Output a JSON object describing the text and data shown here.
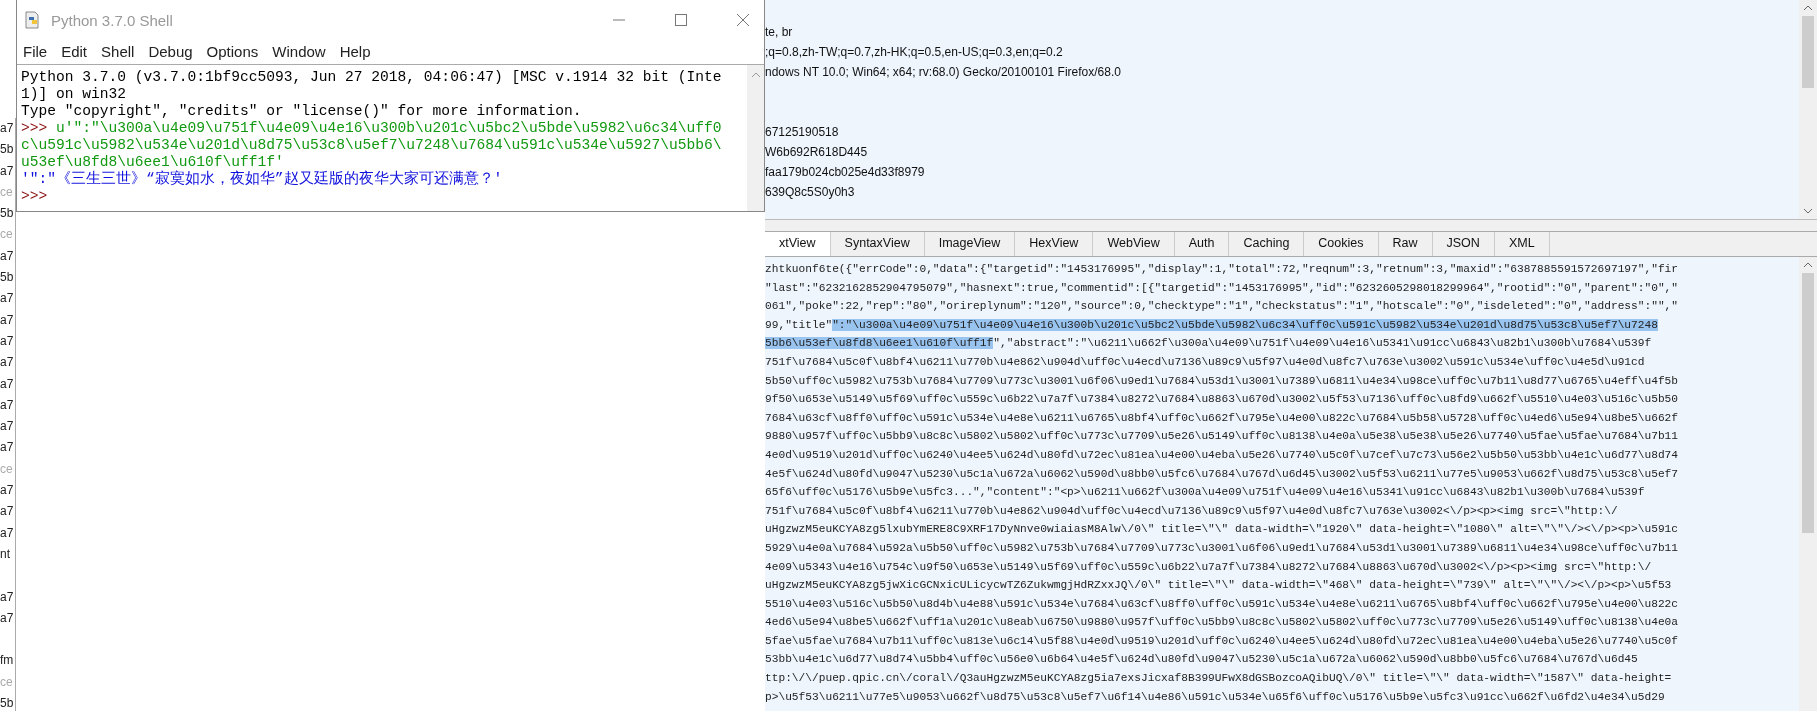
{
  "sessions": [
    {
      "kind": "text",
      "text": "a7",
      "dimmed": false
    },
    {
      "kind": "text",
      "text": "5b",
      "dimmed": false
    },
    {
      "kind": "text",
      "text": "a7",
      "dimmed": false
    },
    {
      "kind": "text",
      "text": "ce",
      "dimmed": true
    },
    {
      "kind": "text",
      "text": "5b",
      "dimmed": false
    },
    {
      "kind": "text",
      "text": "ce",
      "dimmed": true
    },
    {
      "kind": "text",
      "text": "a7",
      "dimmed": false
    },
    {
      "kind": "text",
      "text": "5b",
      "dimmed": false
    },
    {
      "kind": "text",
      "text": "a7",
      "dimmed": false
    },
    {
      "kind": "text",
      "text": "a7",
      "dimmed": false
    },
    {
      "kind": "text",
      "text": "a7",
      "dimmed": false
    },
    {
      "kind": "text",
      "text": "a7",
      "dimmed": false
    },
    {
      "kind": "text",
      "text": "a7",
      "dimmed": false
    },
    {
      "kind": "text",
      "text": "a7",
      "dimmed": false
    },
    {
      "kind": "text",
      "text": "a7",
      "dimmed": false
    },
    {
      "kind": "text",
      "text": "a7",
      "dimmed": false
    },
    {
      "kind": "text",
      "text": "ce",
      "dimmed": true
    },
    {
      "kind": "text",
      "text": "a7",
      "dimmed": false
    },
    {
      "kind": "text",
      "text": "a7",
      "dimmed": false
    },
    {
      "kind": "text",
      "text": "a7",
      "dimmed": false
    },
    {
      "kind": "text",
      "text": "nt",
      "dimmed": false
    },
    {
      "kind": "blank"
    },
    {
      "kind": "text",
      "text": "a7",
      "dimmed": false
    },
    {
      "kind": "text",
      "text": "a7",
      "dimmed": false
    },
    {
      "kind": "blank"
    },
    {
      "kind": "text",
      "text": "fm",
      "dimmed": false
    },
    {
      "kind": "text",
      "text": "ce",
      "dimmed": true
    },
    {
      "kind": "text",
      "text": "5b",
      "dimmed": false
    }
  ],
  "shell": {
    "title": "Python 3.7.0 Shell",
    "menu": [
      "File",
      "Edit",
      "Shell",
      "Debug",
      "Options",
      "Window",
      "Help"
    ],
    "lines": [
      {
        "parts": [
          {
            "kind": "stdout",
            "text": "Python 3.7.0 (v3.7.0:1bf9cc5093, Jun 27 2018, 04:06:47) [MSC v.1914 32 bit (Inte"
          }
        ]
      },
      {
        "parts": [
          {
            "kind": "stdout",
            "text": "1)] on win32"
          }
        ]
      },
      {
        "parts": [
          {
            "kind": "stdout",
            "text": "Type \"copyright\", \"credits\" or \"license()\" for more information."
          }
        ]
      },
      {
        "parts": [
          {
            "kind": "prompt",
            "text": ">>>"
          },
          {
            "kind": "stdin",
            "text": " u'\":\"\\u300a\\u4e09\\u751f\\u4e09\\u4e16\\u300b\\u201c\\u5bc2\\u5bde\\u5982\\u6c34\\uff0"
          }
        ]
      },
      {
        "parts": [
          {
            "kind": "stdin",
            "text": "c\\u591c\\u5982\\u534e\\u201d\\u8d75\\u53c8\\u5ef7\\u7248\\u7684\\u591c\\u534e\\u5927\\u5bb6\\"
          }
        ]
      },
      {
        "parts": [
          {
            "kind": "stdin",
            "text": "u53ef\\u8fd8\\u6ee1\\u610f\\uff1f'"
          }
        ]
      },
      {
        "parts": [
          {
            "kind": "result",
            "text": "'\":\"《三生三世》“寂寞如水，夜如华”赵又廷版的夜华大家可还满意？'"
          }
        ]
      },
      {
        "parts": [
          {
            "kind": "prompt",
            "text": ">>>"
          }
        ]
      }
    ]
  },
  "inspector": {
    "header_lines": [
      {
        "kind": "blank"
      },
      {
        "kind": "text",
        "text": "te, br"
      },
      {
        "kind": "text",
        "text": ";q=0.8,zh-TW;q=0.7,zh-HK;q=0.5,en-US;q=0.3,en;q=0.2"
      },
      {
        "kind": "text",
        "text": "ndows NT 10.0; Win64; x64; rv:68.0) Gecko/20100101 Firefox/68.0"
      },
      {
        "kind": "blank"
      },
      {
        "kind": "blank"
      },
      {
        "kind": "text",
        "text": "67125190518"
      },
      {
        "kind": "text",
        "text": "W6b692R618D445"
      },
      {
        "kind": "text",
        "text": "faa179b024cb025e4d33f8979"
      },
      {
        "kind": "text",
        "text": "639Q8c5S0y0h3"
      }
    ],
    "tabs": [
      {
        "label": "xtView",
        "selected": true
      },
      {
        "label": "SyntaxView",
        "selected": false
      },
      {
        "label": "ImageView",
        "selected": false
      },
      {
        "label": "HexView",
        "selected": false
      },
      {
        "label": "WebView",
        "selected": false
      },
      {
        "label": "Auth",
        "selected": false
      },
      {
        "label": "Caching",
        "selected": false
      },
      {
        "label": "Cookies",
        "selected": false
      },
      {
        "label": "Raw",
        "selected": false
      },
      {
        "label": "JSON",
        "selected": false
      },
      {
        "label": "XML",
        "selected": false
      }
    ],
    "body_lines": [
      {
        "parts": [
          {
            "text": "zhtkuonf6te({\"errCode\":0,\"data\":{\"targetid\":\"1453176995\",\"display\":1,\"total\":72,\"reqnum\":3,\"retnum\":3,\"maxid\":\"6387885591572697197\",\"fir",
            "highlighted": false
          }
        ]
      },
      {
        "parts": [
          {
            "text": "\"last\":\"6232162852904795079\",\"hasnext\":true,\"commentid\":[{\"targetid\":\"1453176995\",\"id\":\"6232605298018299964\",\"rootid\":\"0\",\"parent\":\"0\",\"",
            "highlighted": false
          }
        ]
      },
      {
        "parts": [
          {
            "text": "061\",\"poke\":22,\"rep\":\"80\",\"orireplynum\":\"120\",\"source\":0,\"checktype\":\"1\",\"checkstatus\":\"1\",\"hotscale\":\"0\",\"isdeleted\":\"0\",\"address\":\"\",\"",
            "highlighted": false
          }
        ]
      },
      {
        "parts": [
          {
            "text": "99,\"title\"",
            "highlighted": false
          },
          {
            "text": "\":\"\\u300a\\u4e09\\u751f\\u4e09\\u4e16\\u300b\\u201c\\u5bc2\\u5bde\\u5982\\u6c34\\uff0c\\u591c\\u5982\\u534e\\u201d\\u8d75\\u53c8\\u5ef7\\u7248",
            "highlighted": true
          }
        ]
      },
      {
        "parts": [
          {
            "text": "5bb6\\u53ef\\u8fd8\\u6ee1\\u610f\\uff1f",
            "highlighted": true
          },
          {
            "text": "\",\"abstract\":\"\\u6211\\u662f\\u300a\\u4e09\\u751f\\u4e09\\u4e16\\u5341\\u91cc\\u6843\\u82b1\\u300b\\u7684\\u539f",
            "highlighted": false
          }
        ]
      },
      {
        "parts": [
          {
            "text": "751f\\u7684\\u5c0f\\u8bf4\\u6211\\u770b\\u4e862\\u904d\\uff0c\\u4ecd\\u7136\\u89c9\\u5f97\\u4e0d\\u8fc7\\u763e\\u3002\\u591c\\u534e\\uff0c\\u4e5d\\u91cd",
            "highlighted": false
          }
        ]
      },
      {
        "parts": [
          {
            "text": "5b50\\uff0c\\u5982\\u753b\\u7684\\u7709\\u773c\\u3001\\u6f06\\u9ed1\\u7684\\u53d1\\u3001\\u7389\\u6811\\u4e34\\u98ce\\uff0c\\u7b11\\u8d77\\u6765\\u4eff\\u4f5b",
            "highlighted": false
          }
        ]
      },
      {
        "parts": [
          {
            "text": "9f50\\u653e\\u5149\\u5f69\\uff0c\\u559c\\u6b22\\u7a7f\\u7384\\u8272\\u7684\\u8863\\u670d\\u3002\\u5f53\\u7136\\uff0c\\u8fd9\\u662f\\u5510\\u4e03\\u516c\\u5b50",
            "highlighted": false
          }
        ]
      },
      {
        "parts": [
          {
            "text": "7684\\u63cf\\u8ff0\\uff0c\\u591c\\u534e\\u4e8e\\u6211\\u6765\\u8bf4\\uff0c\\u662f\\u795e\\u4e00\\u822c\\u7684\\u5b58\\u5728\\uff0c\\u4ed6\\u5e94\\u8be5\\u662f",
            "highlighted": false
          }
        ]
      },
      {
        "parts": [
          {
            "text": "9880\\u957f\\uff0c\\u5bb9\\u8c8c\\u5802\\u5802\\uff0c\\u773c\\u7709\\u5e26\\u5149\\uff0c\\u8138\\u4e0a\\u5e38\\u5e38\\u5e26\\u7740\\u5fae\\u5fae\\u7684\\u7b11",
            "highlighted": false
          }
        ]
      },
      {
        "parts": [
          {
            "text": "4e0d\\u9519\\u201d\\uff0c\\u6240\\u4ee5\\u624d\\u80fd\\u72ec\\u81ea\\u4e00\\u4eba\\u5e26\\u7740\\u5c0f\\u7cef\\u7c73\\u56e2\\u5b50\\u53bb\\u4e1c\\u6d77\\u8d74",
            "highlighted": false
          }
        ]
      },
      {
        "parts": [
          {
            "text": "4e5f\\u624d\\u80fd\\u9047\\u5230\\u5c1a\\u672a\\u6062\\u590d\\u8bb0\\u5fc6\\u7684\\u767d\\u6d45\\u3002\\u5f53\\u6211\\u77e5\\u9053\\u662f\\u8d75\\u53c8\\u5ef7",
            "highlighted": false
          }
        ]
      },
      {
        "parts": [
          {
            "text": "65f6\\uff0c\\u5176\\u5b9e\\u5fc3...\",\"content\":\"<p>\\u6211\\u662f\\u300a\\u4e09\\u751f\\u4e09\\u4e16\\u5341\\u91cc\\u6843\\u82b1\\u300b\\u7684\\u539f",
            "highlighted": false
          }
        ]
      },
      {
        "parts": [
          {
            "text": "751f\\u7684\\u5c0f\\u8bf4\\u6211\\u770b\\u4e862\\u904d\\uff0c\\u4ecd\\u7136\\u89c9\\u5f97\\u4e0d\\u8fc7\\u763e\\u3002<\\/p><p><img src=\\\"http:\\/",
            "highlighted": false
          }
        ]
      },
      {
        "parts": [
          {
            "text": "uHgzwzM5euKCYA8zg5lxubYmERE8C9XRF17DyNnve0wiaiasM8Alw\\/0\\\" title=\\\"\\\" data-width=\\\"1920\\\" data-height=\\\"1080\\\" alt=\\\"\\\"\\/><\\/p><p>\\u591c",
            "highlighted": false
          }
        ]
      },
      {
        "parts": [
          {
            "text": "5929\\u4e0a\\u7684\\u592a\\u5b50\\uff0c\\u5982\\u753b\\u7684\\u7709\\u773c\\u3001\\u6f06\\u9ed1\\u7684\\u53d1\\u3001\\u7389\\u6811\\u4e34\\u98ce\\uff0c\\u7b11",
            "highlighted": false
          }
        ]
      },
      {
        "parts": [
          {
            "text": "4e09\\u5343\\u4e16\\u754c\\u9f50\\u653e\\u5149\\u5f69\\uff0c\\u559c\\u6b22\\u7a7f\\u7384\\u8272\\u7684\\u8863\\u670d\\u3002<\\/p><p><img src=\\\"http:\\/",
            "highlighted": false
          }
        ]
      },
      {
        "parts": [
          {
            "text": "uHgzwzM5euKCYA8zg5jwXicGCNxicULicycwTZ6ZukwmgjHdRZxxJQ\\/0\\\" title=\\\"\\\" data-width=\\\"468\\\" data-height=\\\"739\\\" alt=\\\"\\\"\\/><\\/p><p>\\u5f53",
            "highlighted": false
          }
        ]
      },
      {
        "parts": [
          {
            "text": "5510\\u4e03\\u516c\\u5b50\\u8d4b\\u4e88\\u591c\\u534e\\u7684\\u63cf\\u8ff0\\uff0c\\u591c\\u534e\\u4e8e\\u6211\\u6765\\u8bf4\\uff0c\\u662f\\u795e\\u4e00\\u822c",
            "highlighted": false
          }
        ]
      },
      {
        "parts": [
          {
            "text": "4ed6\\u5e94\\u8be5\\u662f\\uff1a\\u201c\\u8eab\\u6750\\u9880\\u957f\\uff0c\\u5bb9\\u8c8c\\u5802\\u5802\\uff0c\\u773c\\u7709\\u5e26\\u5149\\uff0c\\u8138\\u4e0a",
            "highlighted": false
          }
        ]
      },
      {
        "parts": [
          {
            "text": "5fae\\u5fae\\u7684\\u7b11\\uff0c\\u813e\\u6c14\\u5f88\\u4e0d\\u9519\\u201d\\uff0c\\u6240\\u4ee5\\u624d\\u80fd\\u72ec\\u81ea\\u4e00\\u4eba\\u5e26\\u7740\\u5c0f",
            "highlighted": false
          }
        ]
      },
      {
        "parts": [
          {
            "text": "53bb\\u4e1c\\u6d77\\u8d74\\u5bb4\\uff0c\\u56e0\\u6b64\\u4e5f\\u624d\\u80fd\\u9047\\u5230\\u5c1a\\u672a\\u6062\\u590d\\u8bb0\\u5fc6\\u7684\\u767d\\u6d45",
            "highlighted": false
          }
        ]
      },
      {
        "parts": [
          {
            "text": "ttp:\\/\\/puep.qpic.cn\\/coral\\/Q3auHgzwzM5euKCYA8zg5ia7exsJicxaf8B399UFwX8dGSBozcoAQibUQ\\/0\\\" title=\\\"\\\" data-width=\\\"1587\\\" data-height=",
            "highlighted": false
          }
        ]
      },
      {
        "parts": [
          {
            "text": "p>\\u5f53\\u6211\\u77e5\\u9053\\u662f\\u8d75\\u53c8\\u5ef7\\u6f14\\u4e86\\u591c\\u534e\\u65f6\\uff0c\\u5176\\u5b9e\\u5fc3\\u91cc\\u662f\\u6fd2\\u4e34\\u5d29",
            "highlighted": false
          }
        ]
      }
    ]
  }
}
